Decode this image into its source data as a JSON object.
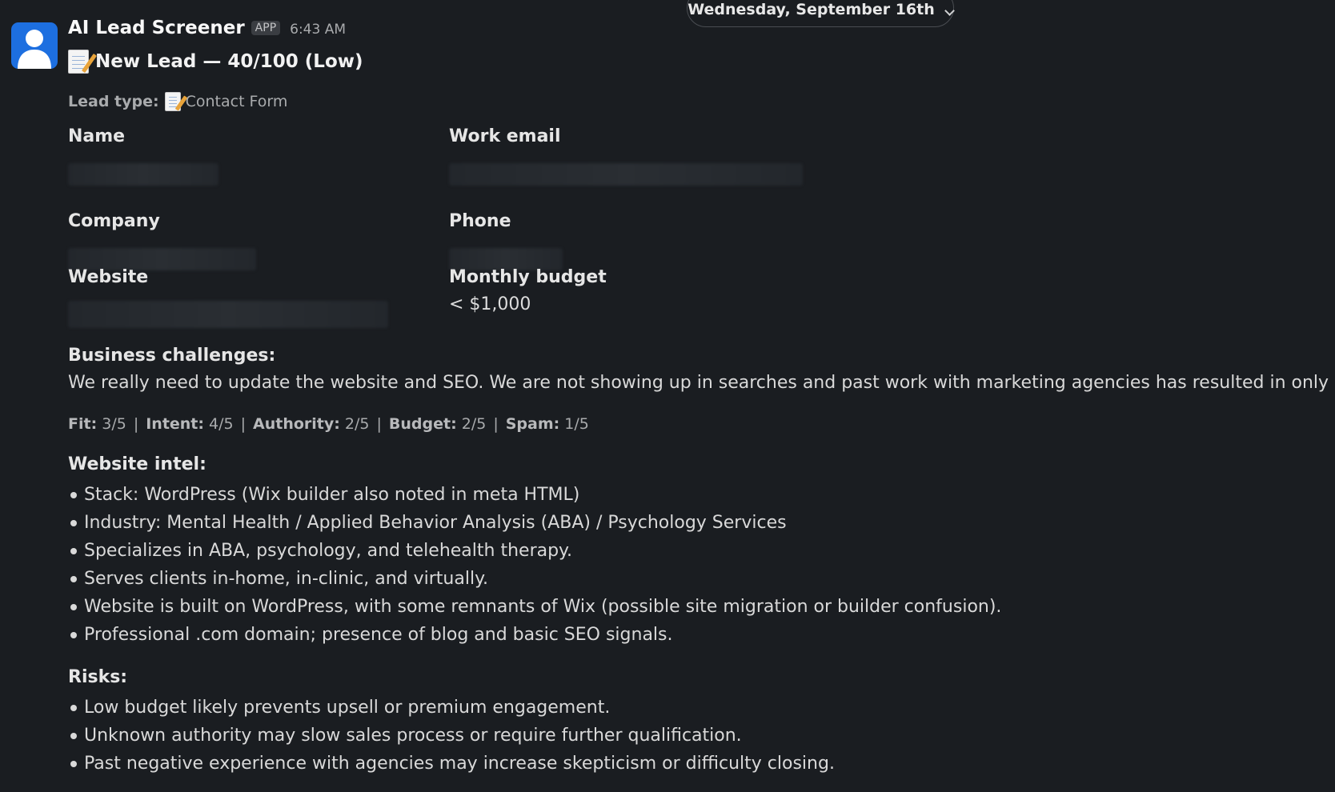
{
  "date_divider": {
    "label": "Wednesday, September 16th"
  },
  "message": {
    "sender": "AI Lead Screener",
    "badge": "APP",
    "time": "6:43 AM",
    "title": "New Lead — 40/100 (Low)",
    "lead_type_label": "Lead type:",
    "lead_type_value": "Contact Form",
    "fields": {
      "name_label": "Name",
      "work_email_label": "Work email",
      "company_label": "Company",
      "phone_label": "Phone",
      "website_label": "Website",
      "budget_label": "Monthly budget",
      "budget_value": "< $1,000"
    },
    "challenges": {
      "title": "Business challenges:",
      "text": "We really need to update the website and SEO. We are not showing up in searches and past work with marketing agencies has resulted in only bots."
    },
    "scores": [
      {
        "label": "Fit:",
        "value": "3/5"
      },
      {
        "label": "Intent:",
        "value": "4/5"
      },
      {
        "label": "Authority:",
        "value": "2/5"
      },
      {
        "label": "Budget:",
        "value": "2/5"
      },
      {
        "label": "Spam:",
        "value": "1/5"
      }
    ],
    "score_separator": "|",
    "website_intel": {
      "title": "Website intel:",
      "items": [
        "Stack: WordPress (Wix builder also noted in meta HTML)",
        "Industry: Mental Health / Applied Behavior Analysis (ABA) / Psychology Services",
        "Specializes in ABA, psychology, and telehealth therapy.",
        "Serves clients in-home, in-clinic, and virtually.",
        "Website is built on WordPress, with some remnants of Wix (possible site migration or builder confusion).",
        "Professional .com domain; presence of blog and basic SEO signals."
      ]
    },
    "risks": {
      "title": "Risks:",
      "items": [
        "Low budget likely prevents upsell or premium engagement.",
        "Unknown authority may slow sales process or require further qualification.",
        "Past negative experience with agencies may increase skepticism or difficulty closing."
      ]
    }
  },
  "colors": {
    "background": "#1a1d21",
    "avatar": "#1d6fe0",
    "text": "#d1d2d3",
    "muted": "#a9abad"
  }
}
